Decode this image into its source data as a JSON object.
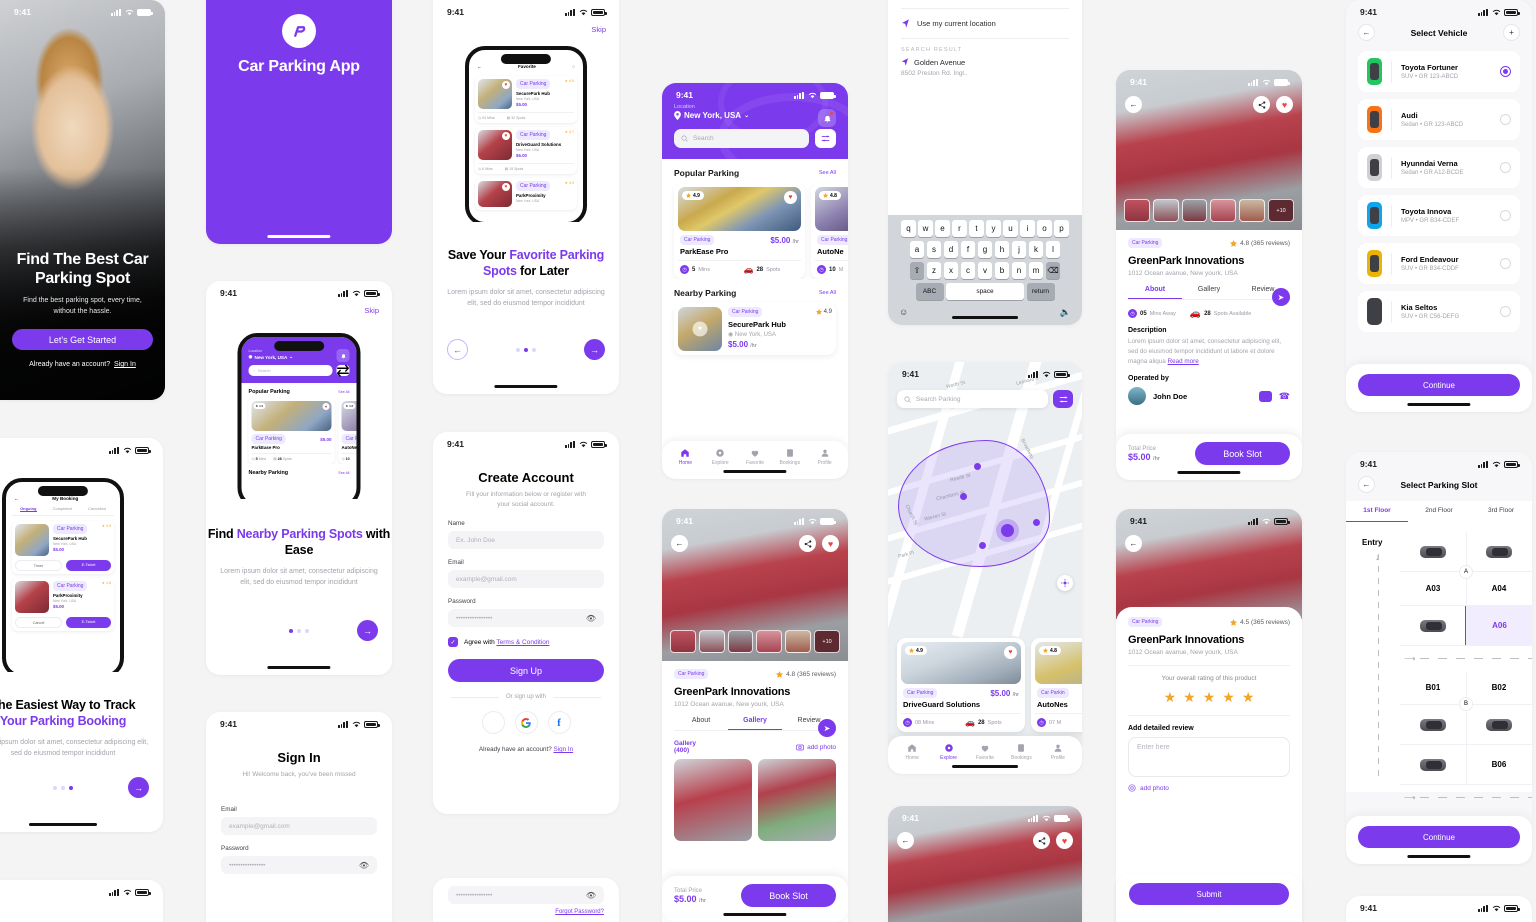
{
  "brand": {
    "accent": "#7C3AED",
    "name": "Car Parking App",
    "logo_icon": "parking-logo-icon"
  },
  "status_bar": {
    "time": "9:41"
  },
  "hero": {
    "title": "Find The Best Car Parking Spot",
    "subtitle": "Find the best parking spot, every time, without the hassle.",
    "cta": "Let's Get Started",
    "account_prompt": "Already have an account?",
    "sign_in": "Sign In"
  },
  "splash": {
    "title": "Car Parking App"
  },
  "onboarding": {
    "skip": "Skip",
    "body": "Lorem ipsum dolor sit amet, consectetur adipiscing elit, sed do eiusmod tempor incididunt",
    "slides": [
      {
        "title_a": "Find ",
        "title_b": "Nearby Parking Spots",
        "title_c": " with Ease",
        "active_dot": 0
      },
      {
        "title_a": "Save Your ",
        "title_b": "Favorite Parking Spots",
        "title_c": " for Later",
        "active_dot": 1
      },
      {
        "title_a": "The Easiest Way to Track",
        "title_b": "Your Parking Booking",
        "title_c": "",
        "active_dot": 2
      }
    ]
  },
  "home": {
    "location_label": "Location",
    "location_value": "New York, USA",
    "search_placeholder": "Search",
    "sections": [
      {
        "title": "Popular Parking",
        "see_all": "See All"
      },
      {
        "title": "Nearby Parking",
        "see_all": "See All"
      }
    ],
    "popular": [
      {
        "tag": "Car Parking",
        "name": "ParkEase Pro",
        "price": "$5.00",
        "unit": "/hr",
        "rating": "4.9",
        "time": "5",
        "time_unit": "Mins",
        "spots": "28",
        "spots_unit": "Spots"
      },
      {
        "tag": "Car Parking",
        "name": "AutoNe",
        "price": "",
        "unit": "",
        "rating": "4.8",
        "time": "10",
        "time_unit": "M",
        "spots": "",
        "spots_unit": ""
      }
    ],
    "nearby": [
      {
        "tag": "Car Parking",
        "name": "SecurePark Hub",
        "city": "New York, USA",
        "price": "$5.00",
        "unit": "/hr",
        "rating": "4.9"
      }
    ],
    "tabs": [
      {
        "label": "Home",
        "icon": "home-icon",
        "active": true
      },
      {
        "label": "Explore",
        "icon": "compass-icon",
        "active": false
      },
      {
        "label": "Favorite",
        "icon": "heart-icon",
        "active": false
      },
      {
        "label": "Bookings",
        "icon": "ticket-icon",
        "active": false
      },
      {
        "label": "Profile",
        "icon": "person-icon",
        "active": false
      }
    ]
  },
  "search_screen": {
    "current_location": "Use my current location",
    "result_label": "SEARCH RESULT",
    "result_title": "Golden Avenue",
    "result_sub": "8502 Preston Rd. Ingl..",
    "keyboard": {
      "row1": [
        "q",
        "w",
        "e",
        "r",
        "t",
        "y",
        "u",
        "i",
        "o",
        "p"
      ],
      "row2": [
        "a",
        "s",
        "d",
        "f",
        "g",
        "h",
        "j",
        "k",
        "l"
      ],
      "row3": [
        "z",
        "x",
        "c",
        "v",
        "b",
        "n",
        "m"
      ],
      "shift": "⇧",
      "backspace": "⌫",
      "abc": "ABC",
      "space": "space",
      "return": "return",
      "emoji": "☺",
      "mic": "🎙"
    }
  },
  "map_screen": {
    "search_placeholder": "Search Parking",
    "streets": [
      "Worth St",
      "Leonard c.",
      "Broadway",
      "Reade St",
      "Chambers St",
      "Warren St",
      "Church St",
      "Park Pl"
    ],
    "cards": [
      {
        "tag": "Car Parking",
        "name": "DriveGuard Solutions",
        "price": "$5.00",
        "unit": "/hr",
        "rating": "4.9",
        "time": "08 Mins",
        "spots": "28",
        "spots_unit": "Spots"
      },
      {
        "tag": "Car Parkin",
        "name": "AutoNes",
        "price": "",
        "unit": "",
        "rating": "4.8",
        "time": "07 M",
        "spots": "",
        "spots_unit": ""
      }
    ],
    "tabs": [
      {
        "label": "Home",
        "active": false
      },
      {
        "label": "Explore",
        "active": true
      },
      {
        "label": "Favorite",
        "active": false
      },
      {
        "label": "Bookings",
        "active": false
      },
      {
        "label": "Profile",
        "active": false
      }
    ]
  },
  "detail": {
    "tag": "Car Parking",
    "rating": "4.8 (365 reviews)",
    "title": "GreenPark Innovations",
    "address": "1012 Ocean avanue, New yourk, USA",
    "tabs": [
      {
        "label": "About",
        "active": true
      },
      {
        "label": "Gallery",
        "active": false
      },
      {
        "label": "Review",
        "active": false
      }
    ],
    "mins_value": "05",
    "mins_label": "Mins Away",
    "spots_value": "28",
    "spots_label": "Spots Available",
    "description_title": "Description",
    "description": "Lorem ipsum dolor sit amet, consectetur adipiscing elit, sed do eiusmod tempor incididunt ut labore et dolore magna aliqua",
    "read_more": "Read more",
    "operated_title": "Operated by",
    "operator": "John Doe",
    "thumb_more": "+10",
    "total_label": "Total Price",
    "price": "$5.00",
    "unit": "/hr",
    "book": "Book Slot"
  },
  "gallery": {
    "tag": "Car Parking",
    "rating": "4.8 (365 reviews)",
    "title": "GreenPark Innovations",
    "address": "1012 Ocean avanue, New yourk, USA",
    "tabs": [
      {
        "label": "About",
        "active": false
      },
      {
        "label": "Gallery",
        "active": true
      },
      {
        "label": "Review",
        "active": false
      }
    ],
    "heading": "Gallery",
    "count": "(400)",
    "add_photo": "add photo",
    "total_label": "Total Price",
    "price": "$5.00",
    "unit": "/hr",
    "book": "Book Slot"
  },
  "review": {
    "tag": "Car Parking",
    "rating": "4.5 (365 reviews)",
    "title": "GreenPark Innovations",
    "address": "1012 Ocean avanue, New yourk, USA",
    "rating_prompt": "Your overall rating of this product",
    "stars_filled": 5,
    "detail_label": "Add detailed review",
    "placeholder": "Enter here",
    "add_photo": "add photo",
    "submit": "Submit"
  },
  "vehicle": {
    "title": "Select Vehicle",
    "continue": "Continue",
    "items": [
      {
        "name": "Toyota Fortuner",
        "sub": "SUV  •  GR 123-ABCD",
        "color": "#22c55e",
        "selected": true
      },
      {
        "name": "Audi",
        "sub": "Sedan  •  GR 123-ABCD",
        "color": "#f97316",
        "selected": false
      },
      {
        "name": "Hyunndai Verna",
        "sub": "Sedan  •  GR A12-BCDE",
        "color": "#cfcfd4",
        "selected": false
      },
      {
        "name": "Toyota Innova",
        "sub": "MPV  •  GR B34-CDEF",
        "color": "#0ea5e9",
        "selected": false
      },
      {
        "name": "Ford Endeavour",
        "sub": "SUV  •  GR B34-CDDF",
        "color": "#eab308",
        "selected": false
      },
      {
        "name": "Kia Seltos",
        "sub": "SUV  •  GR C56-DEFG",
        "color": "#3f3f46",
        "selected": false
      }
    ]
  },
  "slot": {
    "title": "Select Parking Slot",
    "floors": [
      {
        "label": "1st Floor",
        "active": true
      },
      {
        "label": "2nd Floor",
        "active": false
      },
      {
        "label": "3rd Floor",
        "active": false
      }
    ],
    "entry": "Entry",
    "zone_a": "A",
    "zone_b": "B",
    "cells": [
      "A03",
      "A04",
      "A06",
      "B01",
      "B02",
      "B06"
    ],
    "selected_cell": "A06",
    "continue": "Continue"
  },
  "create_account": {
    "title": "Create Account",
    "subtitle": "Fill your information below or register with your social account.",
    "name_label": "Name",
    "name_placeholder": "Ex. John Doe",
    "email_label": "Email",
    "email_placeholder": "example@gmail.com",
    "password_label": "Password",
    "password_value": "••••••••••••••••",
    "agree_prefix": "Agree with ",
    "agree_link": "Terms & Condition",
    "submit": "Sign Up",
    "or": "Or sign up with",
    "socials": [
      "apple-icon",
      "google-icon",
      "facebook-icon"
    ],
    "have_account": "Already  have an account?",
    "sign_in": "Sign In"
  },
  "sign_in": {
    "title": "Sign In",
    "subtitle": "Hi! Welcome back, you've been missed",
    "email_label": "Email",
    "email_placeholder": "example@gmail.com",
    "password_label": "Password",
    "password_value": "••••••••••••••••",
    "forgot": "Forgot Password?"
  },
  "booking_mock": {
    "title": "My Booking",
    "tabs": [
      "Ongoing",
      "Completed",
      "Cancelled"
    ],
    "rows": [
      {
        "tag": "Car Parking",
        "name": "SecurePark Hub",
        "city": "New York, USA",
        "price": "$5.00",
        "unit": "/hr",
        "rating": "4.9",
        "btn_a": "Timer",
        "btn_b": "E-Ticket"
      },
      {
        "tag": "Car Parking",
        "name": "ParkProximity",
        "city": "New York, USA",
        "price": "$5.00",
        "unit": "/hr",
        "rating": "4.8",
        "btn_a": "Cancel",
        "btn_b": "E-Ticket"
      }
    ]
  },
  "favorite_mock": {
    "title": "Favorite",
    "rows": [
      {
        "tag": "Car Parking",
        "name": "SecurePark Hub",
        "city": "New York, USA",
        "price": "$5.00",
        "unit": "/hr",
        "rating": "4.9",
        "mins": "04 Mins",
        "spots": "32 Spots"
      },
      {
        "tag": "Car Parking",
        "name": "DriveGuard Solutions",
        "city": "New York, USA",
        "price": "$6.00",
        "unit": "/hr",
        "rating": "4.7",
        "mins": "6 Mins",
        "spots": "15 Spots"
      },
      {
        "tag": "Car Parking",
        "name": "ParkProximity",
        "city": "New York, USA",
        "price": "",
        "unit": "",
        "rating": "4.9",
        "mins": "",
        "spots": ""
      }
    ]
  }
}
